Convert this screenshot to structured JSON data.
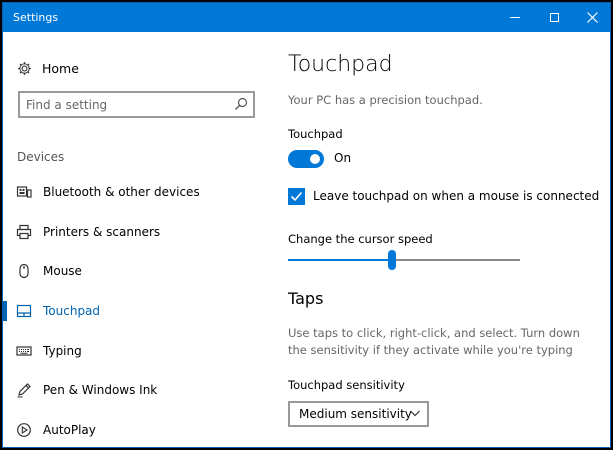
{
  "window": {
    "title": "Settings"
  },
  "sidebar": {
    "home_label": "Home",
    "search_placeholder": "Find a setting",
    "section_header": "Devices",
    "items": [
      {
        "label": "Bluetooth & other devices",
        "icon": "bluetooth-devices-icon"
      },
      {
        "label": "Printers & scanners",
        "icon": "printer-icon"
      },
      {
        "label": "Mouse",
        "icon": "mouse-icon"
      },
      {
        "label": "Touchpad",
        "icon": "touchpad-icon",
        "selected": true
      },
      {
        "label": "Typing",
        "icon": "keyboard-icon"
      },
      {
        "label": "Pen & Windows Ink",
        "icon": "pen-icon"
      },
      {
        "label": "AutoPlay",
        "icon": "autoplay-icon"
      }
    ]
  },
  "content": {
    "title": "Touchpad",
    "subtitle": "Your PC has a precision touchpad.",
    "touchpad_label": "Touchpad",
    "toggle_state": "On",
    "toggle_on": true,
    "checkbox_label": "Leave touchpad on when a mouse is connected",
    "checkbox_checked": true,
    "cursor_speed_label": "Change the cursor speed",
    "cursor_speed_fraction": 0.45,
    "taps_title": "Taps",
    "taps_description": "Use taps to click, right-click, and select. Turn down the sensitivity if they activate while you're typing",
    "sensitivity_label": "Touchpad sensitivity",
    "sensitivity_value": "Medium sensitivity"
  },
  "colors": {
    "accent": "#0078d7",
    "titlebar": "#0078d7"
  }
}
